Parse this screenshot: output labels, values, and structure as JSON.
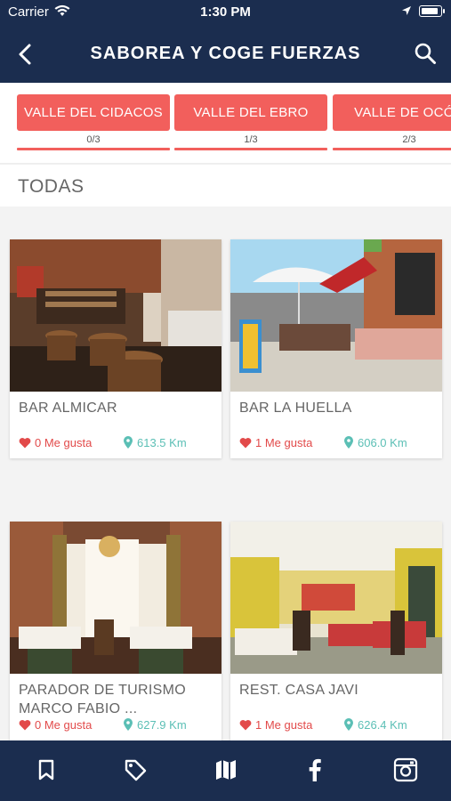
{
  "status": {
    "carrier": "Carrier",
    "time": "1:30 PM"
  },
  "header": {
    "title": "SABOREA Y COGE FUERZAS"
  },
  "filters": [
    {
      "label": "VALLE DEL CIDACOS",
      "count": "0/3"
    },
    {
      "label": "VALLE DEL EBRO",
      "count": "1/3"
    },
    {
      "label": "VALLE DE OCÓN",
      "count": "2/3"
    }
  ],
  "section": {
    "title": "TODAS"
  },
  "places": [
    {
      "name": "BAR ALMICAR",
      "likes": "0 Me gusta",
      "distance": "613.5 Km"
    },
    {
      "name": "BAR LA HUELLA",
      "likes": "1 Me gusta",
      "distance": "606.0 Km"
    },
    {
      "name": "PARADOR DE TURISMO MARCO FABIO ...",
      "likes": "0 Me gusta",
      "distance": "627.9 Km"
    },
    {
      "name": "REST. CASA JAVI",
      "likes": "1 Me gusta",
      "distance": "626.4 Km"
    }
  ],
  "tabbar": [
    "bookmark-icon",
    "tag-icon",
    "map-icon",
    "facebook-icon",
    "instagram-icon"
  ],
  "colors": {
    "navy": "#1b2d4f",
    "accent": "#f25f5c",
    "teal": "#5bbfb5",
    "heart": "#e24a4a"
  }
}
